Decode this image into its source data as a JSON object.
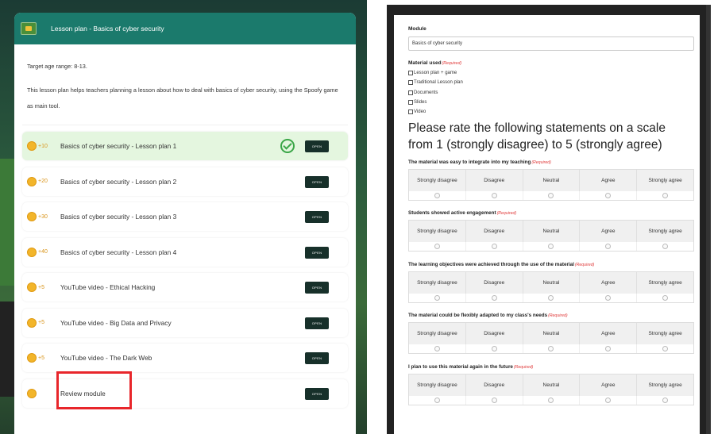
{
  "left": {
    "header_title": "Lesson plan - Basics of cyber security",
    "age_range": "Target age range: 8-13.",
    "description": "This lesson plan helps teachers planning a lesson about how to deal with basics of cyber security, using the  Spoofy game as main tool.",
    "open_label": "OPEN",
    "items": [
      {
        "points": "+10",
        "label": "Basics of cyber security - Lesson plan 1",
        "completed": true
      },
      {
        "points": "+20",
        "label": "Basics of cyber security - Lesson plan 2",
        "completed": false
      },
      {
        "points": "+30",
        "label": "Basics of cyber security - Lesson plan 3",
        "completed": false
      },
      {
        "points": "+40",
        "label": "Basics of cyber security - Lesson plan 4",
        "completed": false
      },
      {
        "points": "+5",
        "label": "YouTube video - Ethical Hacking",
        "completed": false
      },
      {
        "points": "+5",
        "label": "YouTube video - Big Data and Privacy",
        "completed": false
      },
      {
        "points": "+5",
        "label": "YouTube video - The Dark Web",
        "completed": false
      },
      {
        "points": "",
        "label": "Review module",
        "completed": false
      }
    ]
  },
  "right": {
    "module_label": "Module",
    "module_value": "Basics of cyber security",
    "material_label": "Material used",
    "required": "(Required)",
    "materials": [
      "Lesson plan + game",
      "Traditional Lesson plan",
      "Documents",
      "Slides",
      "Video"
    ],
    "rate_heading": "Please rate the following statements on a scale from 1 (strongly disagree) to 5 (strongly agree)",
    "scale": [
      "Strongly disagree",
      "Disagree",
      "Neutral",
      "Agree",
      "Strongly agree"
    ],
    "questions": [
      "The material was easy to integrate into my teaching",
      "Students showed active engagement",
      "The learning objectives were achieved through the use of the material",
      "The material could be flexibly adapted to my class's needs",
      "I plan to use this material again in the future"
    ]
  },
  "colors": {
    "header_teal": "#1b7a6c",
    "coin": "#f2b52a",
    "completed_row": "#e4f6df",
    "check_green": "#3aa647",
    "open_button": "#17302a",
    "highlight_red": "#e8262b",
    "required_red": "#e03a3a"
  }
}
